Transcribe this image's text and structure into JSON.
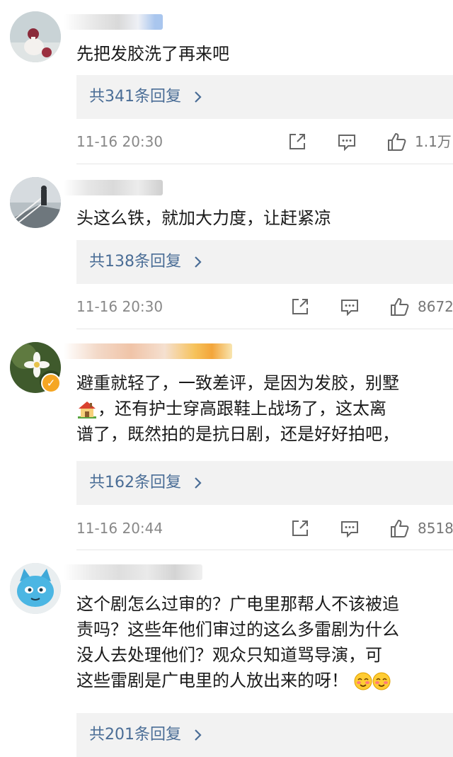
{
  "comments": [
    {
      "text_lines": [
        "先把发胶洗了再来吧"
      ],
      "replies": "共341条回复",
      "time": "11-16 20:30",
      "likes": "1.1万"
    },
    {
      "text_lines": [
        "头这么铁，就加大力度，让赶紧凉"
      ],
      "replies": "共138条回复",
      "time": "11-16 20:30",
      "likes": "8672"
    },
    {
      "text_lines": [
        "避重就轻了，一致差评，是因为发胶，别墅",
        "，还有护士穿高跟鞋上战场了，这太离",
        "谱了，既然拍的是抗日剧，还是好好拍吧，"
      ],
      "replies": "共162条回复",
      "time": "11-16 20:44",
      "likes": "8518"
    },
    {
      "text_lines": [
        "这个剧怎么过审的？广电里那帮人不该被追",
        "责吗？这些年他们审过的这么多雷剧为什么",
        "没人去处理他们？观众只知道骂导演，可",
        "这些雷剧是广电里的人放出来的呀！"
      ],
      "replies": "共201条回复"
    }
  ],
  "icons": {
    "share": "share-icon",
    "comment": "comment-icon",
    "like": "thumbs-up-icon",
    "chevron": "chevron-right-icon",
    "verified": "verified-badge-icon",
    "house_emoji": "house-emoji-icon",
    "face_emoji": "blushing-face-emoji-icon"
  },
  "colors": {
    "reply_link": "#4a6d96",
    "reply_bg": "#f2f2f2",
    "meta_text": "#888888",
    "badge": "#f5a623"
  }
}
